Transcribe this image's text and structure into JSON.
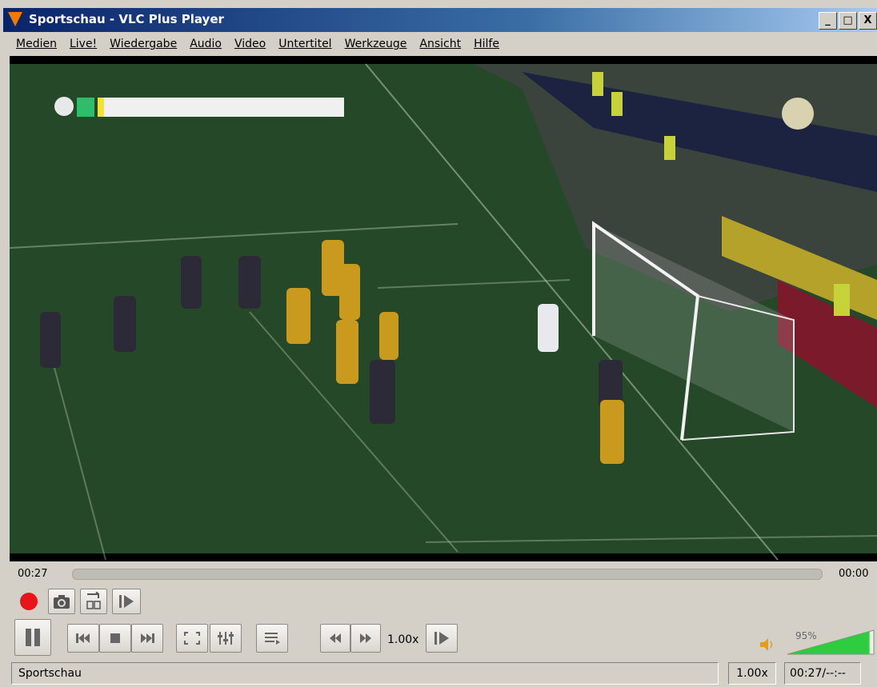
{
  "window": {
    "title": "Sportschau - VLC Plus Player",
    "minimize_label": "_",
    "maximize_label": "□",
    "close_label": "X"
  },
  "menu": {
    "items": [
      "Medien",
      "Live!",
      "Wiedergabe",
      "Audio",
      "Video",
      "Untertitel",
      "Werkzeuge",
      "Ansicht",
      "Hilfe"
    ]
  },
  "playback": {
    "current_time": "00:27",
    "end_time": "00:00",
    "speed_label": "1.00x",
    "progress": 0.0
  },
  "volume": {
    "percent_label": "95%",
    "level": 0.95
  },
  "statusbar": {
    "media_name": "Sportschau",
    "speed": "1.00x",
    "time": "00:27/--:--"
  },
  "colors": {
    "title_gradient_start": "#0a246a",
    "record_red": "#e8141a",
    "volume_green": "#2ecc40",
    "pitch": "#244a27"
  },
  "icons": [
    "record-icon",
    "snapshot-icon",
    "ab-loop-icon",
    "frame-step-icon",
    "pause-icon",
    "previous-icon",
    "stop-icon",
    "next-icon",
    "fullscreen-icon",
    "equalizer-icon",
    "playlist-icon",
    "slower-icon",
    "faster-icon",
    "frame-advance-icon",
    "speaker-icon"
  ]
}
